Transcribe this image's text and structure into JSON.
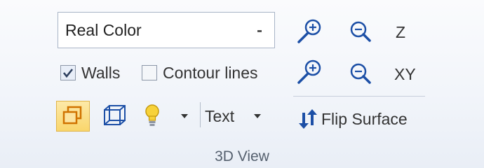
{
  "ribbon": {
    "render_mode": {
      "value": "Real Color"
    },
    "checkboxes": [
      {
        "label": "Walls",
        "checked": true
      },
      {
        "label": "Contour lines",
        "checked": false
      }
    ],
    "zoom": {
      "z_label": "Z",
      "xy_label": "XY"
    },
    "text_button": {
      "label": "Text"
    },
    "flip_surface": {
      "label": "Flip Surface"
    },
    "group_label": "3D View",
    "colors": {
      "accent_blue": "#1c4fa6",
      "selected_fill": "#f9d66c",
      "bulb": "#f7d23a"
    },
    "icons": [
      "zoom-in-icon",
      "zoom-out-icon",
      "window-overlap-icon",
      "box-3d-icon",
      "lightbulb-icon",
      "dropdown-arrow-icon",
      "flip-arrows-icon"
    ]
  }
}
